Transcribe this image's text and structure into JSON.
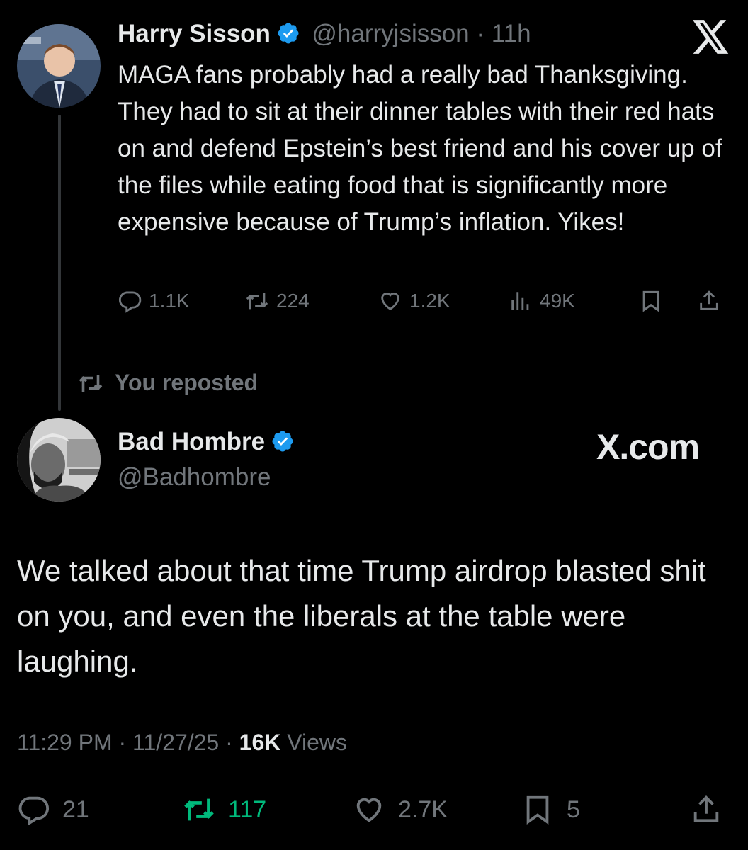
{
  "original": {
    "author_name": "Harry Sisson",
    "handle": "@harryjsisson",
    "time": "11h",
    "text": "MAGA fans probably had a really bad Thanksgiving. They had to sit at their dinner tables with their red hats on and defend Epstein’s best friend and his cover up of the files while eating food that is significantly more expensive because of Trump’s inflation. Yikes!",
    "replies": "1.1K",
    "reposts": "224",
    "likes": "1.2K",
    "views": "49K"
  },
  "repost_label": "You reposted",
  "reply": {
    "author_name": "Bad Hombre",
    "handle": "@Badhombre",
    "text": "We talked about that time Trump airdrop blasted shit on you, and even the liberals at the table were laughing.",
    "time": "11:29 PM",
    "date": "11/27/25",
    "views_count": "16K",
    "views_label": "Views",
    "replies": "21",
    "reposts": "117",
    "likes": "2.7K",
    "bookmarks": "5"
  },
  "watermark": "X.com",
  "colors": {
    "background": "#000000",
    "text": "#e7e9ea",
    "muted": "#71767b",
    "verified": "#1d9bf0",
    "repost_active": "#00ba7c"
  },
  "icons": [
    "verified-badge-icon",
    "x-logo-icon",
    "reply-icon",
    "repost-icon",
    "like-icon",
    "views-icon",
    "bookmark-icon",
    "share-icon"
  ]
}
